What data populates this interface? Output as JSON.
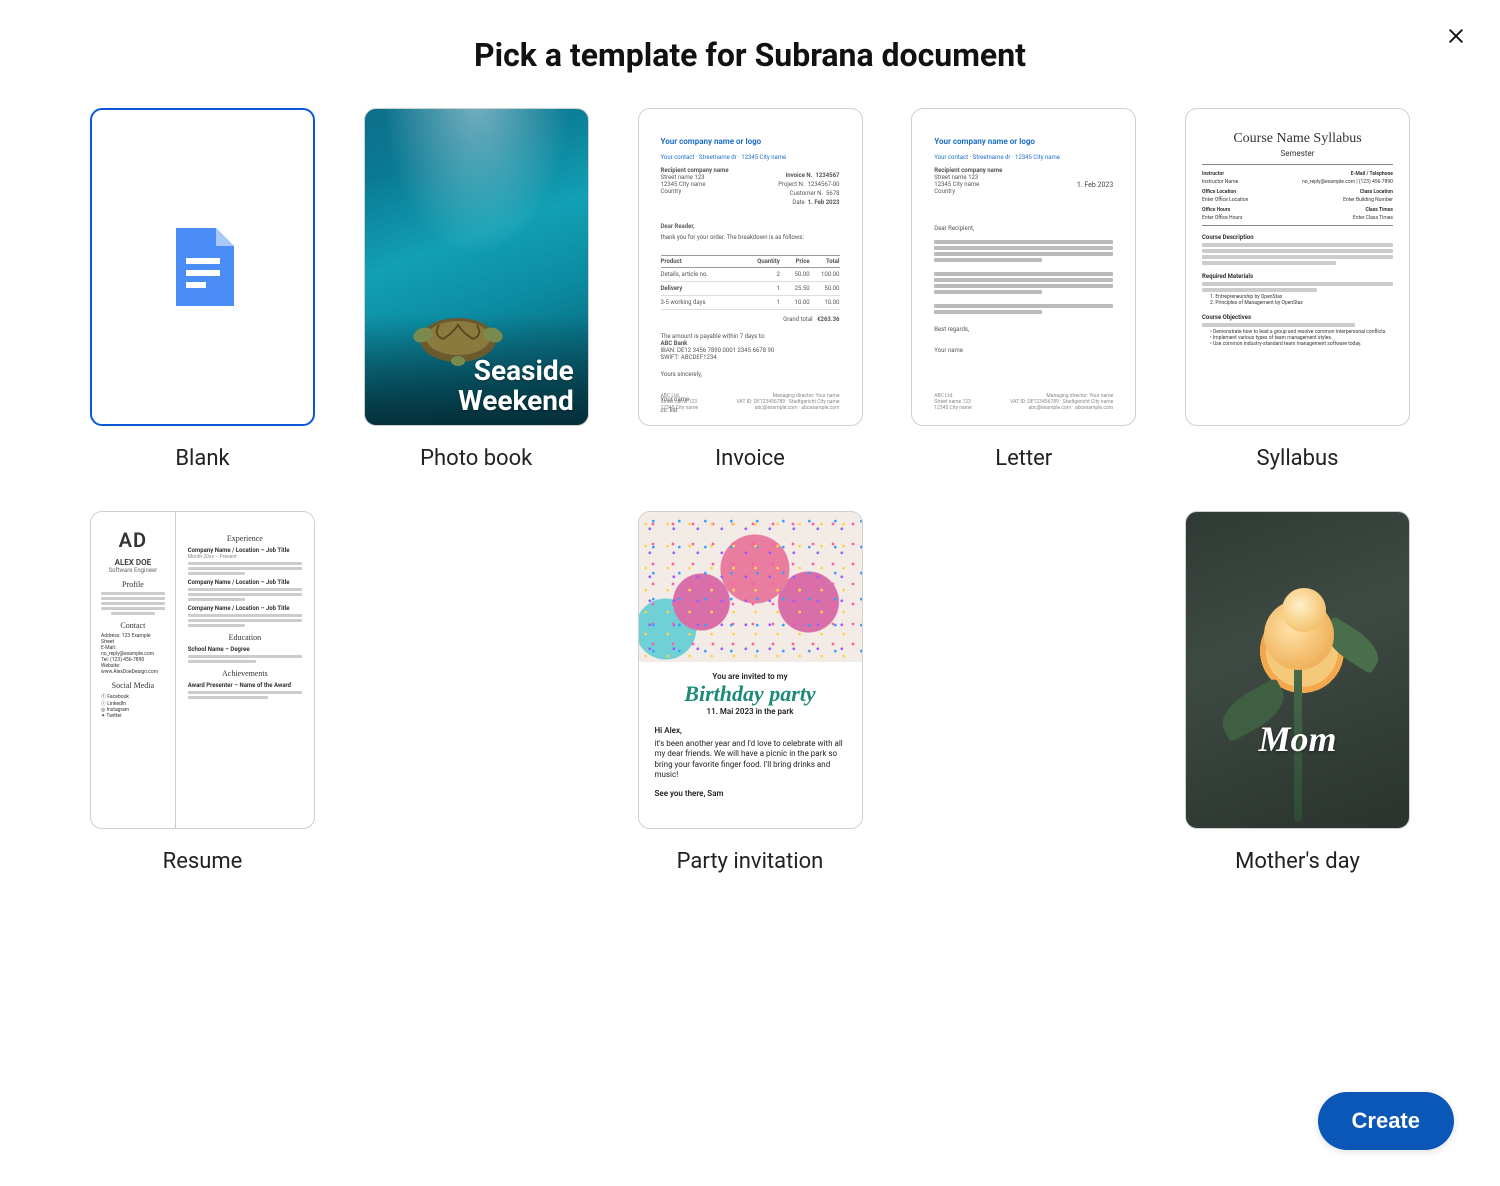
{
  "modal": {
    "title": "Pick a template for Subrana document",
    "close_aria": "Close"
  },
  "templates": [
    {
      "id": "blank",
      "label": "Blank",
      "selected": true
    },
    {
      "id": "photo-book",
      "label": "Photo book",
      "preview": {
        "line1": "Seaside",
        "line2": "Weekend"
      }
    },
    {
      "id": "invoice",
      "label": "Invoice",
      "preview": {
        "company_header": "Your company name or logo",
        "sender_line": "Your contact · Streetname dr · 12345 City name",
        "recipient_name": "Recipient company name",
        "recipient_street": "Street name 123",
        "recipient_city": "12345 City name",
        "recipient_country": "Country",
        "meta": [
          {
            "k": "Invoice N.",
            "v": "1234567"
          },
          {
            "k": "Project N.",
            "v": "1234567-00"
          },
          {
            "k": "Customer N.",
            "v": "5678"
          },
          {
            "k": "Date",
            "v": "1. Feb 2023"
          }
        ],
        "salutation": "Dear Reader,",
        "intro": "thank you for your order. The breakdown is as follows:",
        "columns": [
          "Product",
          "Quantity",
          "Price",
          "Total"
        ],
        "rows": [
          {
            "c1": "Product",
            "c2": "",
            "c3": "",
            "c4": ""
          },
          {
            "c1": "Details, article no.",
            "c2": "2",
            "c3": "50.00",
            "c4": "100.00"
          },
          {
            "c1": "Delivery",
            "c2": "1",
            "c3": "25.50",
            "c4": "50.00"
          },
          {
            "c1": "3-5 working days",
            "c2": "1",
            "c3": "10.00",
            "c4": "10.00"
          }
        ],
        "total_label": "Grand total",
        "total_value": "€263.36",
        "payable": "The amount is payable within 7 days to:",
        "bank_name": "ABC Bank",
        "iban": "IBAN: DE12 3456 7890 0001 2345 6678 90",
        "swift": "SWIFT: ABCDEF1234",
        "closing": "Yours sincerely,",
        "signature": "Your name",
        "cc": "cc: list"
      }
    },
    {
      "id": "letter",
      "label": "Letter",
      "preview": {
        "company_header": "Your company name or logo",
        "sender_line": "Your contact · Streetname dr · 12345 City name",
        "recipient_name": "Recipient company name",
        "recipient_street": "Street name 123",
        "recipient_city": "12345 City name",
        "recipient_country": "Country",
        "date": "1. Feb 2023",
        "salutation": "Dear Recipient,",
        "closing": "Best regards,",
        "signature": "Your name"
      }
    },
    {
      "id": "syllabus",
      "label": "Syllabus",
      "preview": {
        "title": "Course Name Syllabus",
        "semester": "Semester",
        "left_labels": [
          "Instructor",
          "Instructor Name",
          "Office Location",
          "Enter Office Location",
          "Office Hours",
          "Enter Office Hours"
        ],
        "right_labels": [
          "E-Mail / Telephone",
          "no_reply@example.com | (123) 456-7890",
          "Class Location",
          "Enter Building Number",
          "Class Times",
          "Enter Class Times"
        ],
        "sections": [
          "Course Description",
          "Required Materials",
          "Course Objectives"
        ],
        "bullets": [
          "Entrepreneurship by OpenStax",
          "Principles of Management by OpenStax",
          "Demonstrate how to lead a group and resolve common interpersonal conflicts.",
          "Implement various types of team management styles.",
          "Use common industry-standard team management software today."
        ]
      }
    },
    {
      "id": "resume",
      "label": "Resume",
      "preview": {
        "initials": "AD",
        "name": "ALEX DOE",
        "role": "Software Engineer",
        "left_headings": [
          "Profile",
          "Contact",
          "Social Media"
        ],
        "contact_lines": [
          "Address: 123 Example Street",
          "E-Mail: no_reply@example.com",
          "Tel: (123) 456-7890",
          "Website: www.AlexDoeDesign.com"
        ],
        "social": [
          "Facebook",
          "LinkedIn",
          "Instagram",
          "Twitter"
        ],
        "right_headings": [
          "Experience",
          "Education",
          "Achievements"
        ],
        "job_title": "Company Name / Location – Job Title",
        "job_dates": "Month 20xx – Present",
        "edu_title": "School Name – Degree",
        "ach_title": "Award Presenter – Name of the Award"
      }
    },
    {
      "id": "party-invitation",
      "label": "Party invitation",
      "preview": {
        "invited": "You are invited to my",
        "big": "Birthday party",
        "sub": "11. Mai 2023 in the park",
        "hi": "Hi Alex,",
        "body": "it's been another year and I'd love to celebrate with all my dear friends. We will have a picnic in the park so bring your favorite finger food. I'll bring drinks and music!",
        "bye": "See you there, Sam"
      }
    },
    {
      "id": "mothers-day",
      "label": "Mother's day",
      "preview": {
        "text": "Mom"
      }
    }
  ],
  "actions": {
    "create": "Create"
  }
}
